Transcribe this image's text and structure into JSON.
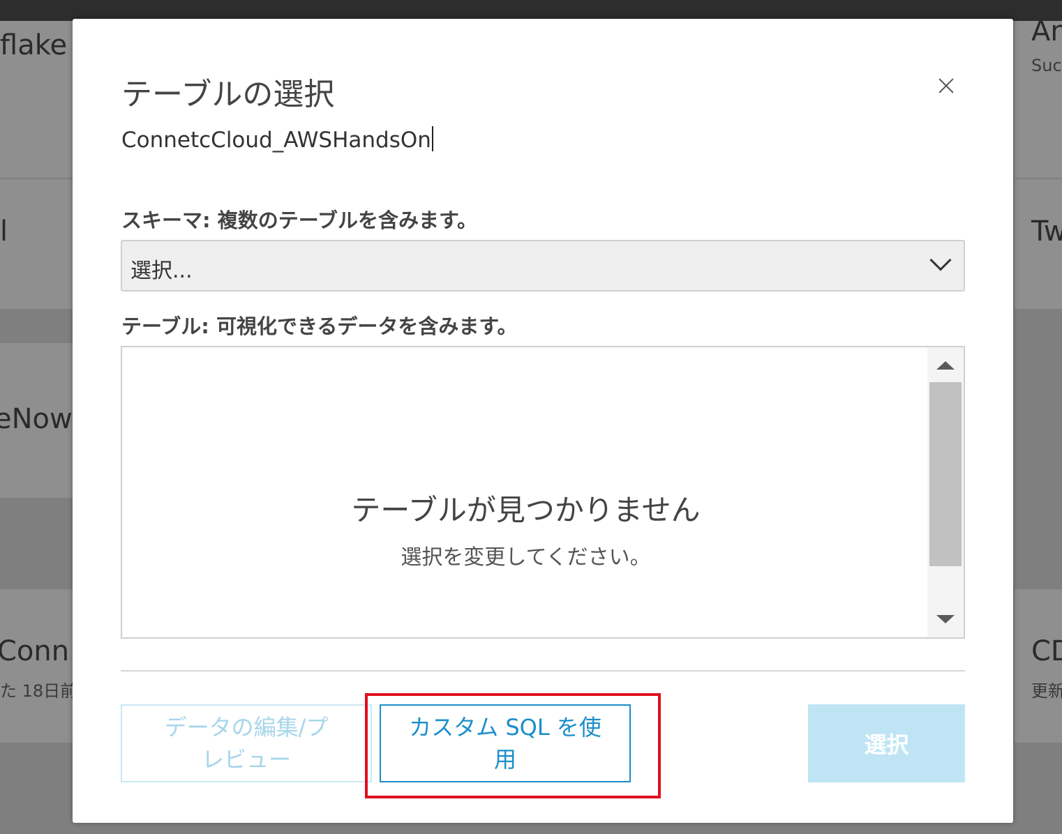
{
  "background_cards": {
    "left_1": {
      "title": "flake"
    },
    "left_2": {
      "title": "l"
    },
    "left_3": {
      "title": "eNow"
    },
    "left_4": {
      "title": "Conn",
      "subtitle": "た 18日前"
    },
    "right_1": {
      "title": "An",
      "subtitle": "Suc"
    },
    "right_2": {
      "title": "Tw"
    },
    "right_3": {
      "title": "CD",
      "subtitle": "更新"
    }
  },
  "dialog": {
    "title": "テーブルの選択",
    "datasource_name": "ConnetcCloud_AWSHandsOn",
    "schema_label": "スキーマ: 複数のテーブルを含みます。",
    "schema_select_value": "選択...",
    "table_label": "テーブル: 可視化できるデータを含みます。",
    "empty_title": "テーブルが見つかりません",
    "empty_subtitle": "選択を変更してください。",
    "buttons": {
      "preview_line1": "データの編集/プ",
      "preview_line2": "レビュー",
      "custom_sql_line1": "カスタム SQL を使",
      "custom_sql_line2": "用",
      "select": "選択"
    }
  },
  "colors": {
    "accent": "#1a8ec9",
    "highlight": "#e0101e",
    "disabled_button": "#bfe5f5"
  }
}
